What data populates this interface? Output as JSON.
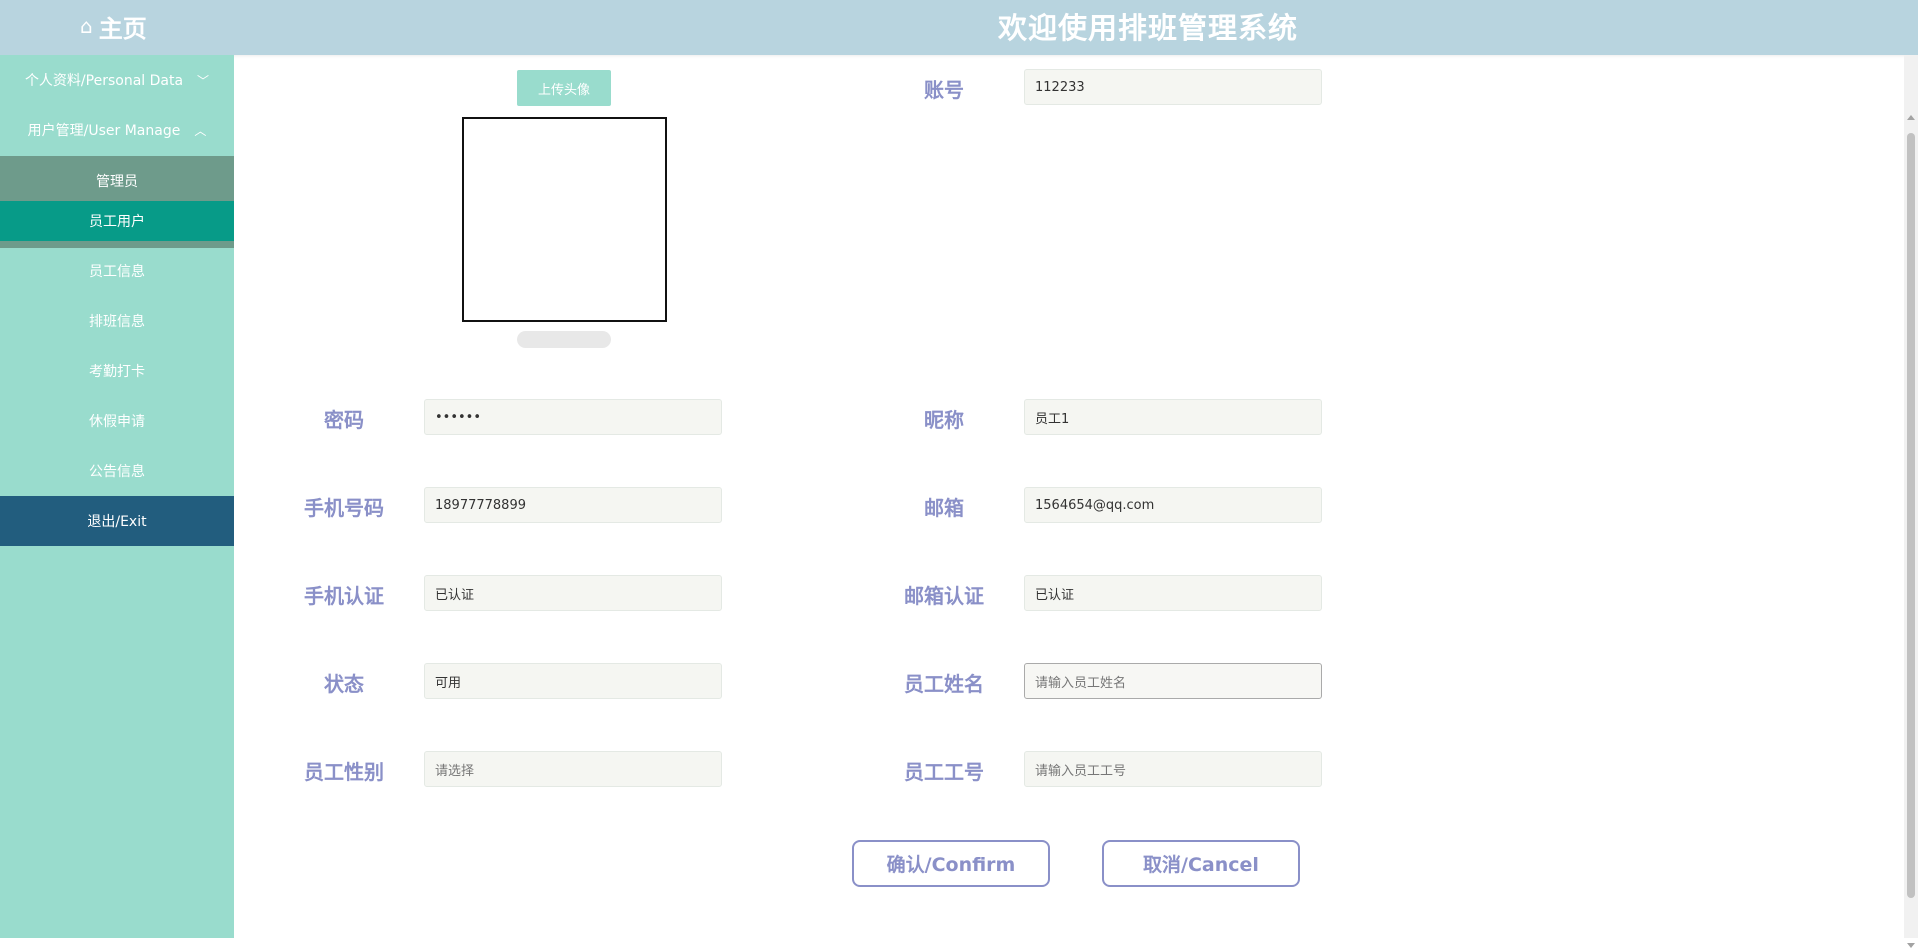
{
  "header": {
    "home_icon": "home-icon",
    "home_label": "主页",
    "title": "欢迎使用排班管理系统"
  },
  "sidebar": {
    "items": [
      {
        "label": "个人资料/Personal Data",
        "icon": "chevron-down-icon"
      },
      {
        "label": "用户管理/User Manage",
        "icon": "chevron-up-icon"
      }
    ],
    "sub_items": [
      {
        "label": "管理员"
      },
      {
        "label": "员工用户"
      }
    ],
    "more_items": [
      {
        "label": "员工信息"
      },
      {
        "label": "排班信息"
      },
      {
        "label": "考勤打卡"
      },
      {
        "label": "休假申请"
      },
      {
        "label": "公告信息"
      }
    ],
    "exit_label": "退出/Exit"
  },
  "form": {
    "upload_label": "上传头像",
    "fields": {
      "account": {
        "label": "账号",
        "value": "112233"
      },
      "password": {
        "label": "密码",
        "value": "••••••"
      },
      "nickname": {
        "label": "昵称",
        "value": "员工1"
      },
      "phone": {
        "label": "手机号码",
        "value": "18977778899"
      },
      "email": {
        "label": "邮箱",
        "value": "1564654@qq.com"
      },
      "phone_verify": {
        "label": "手机认证",
        "value": "已认证"
      },
      "email_verify": {
        "label": "邮箱认证",
        "value": "已认证"
      },
      "status": {
        "label": "状态",
        "value": "可用"
      },
      "staff_name": {
        "label": "员工姓名",
        "placeholder": "请输入员工姓名"
      },
      "staff_gender": {
        "label": "员工性别",
        "placeholder": "请选择"
      },
      "staff_no": {
        "label": "员工工号",
        "placeholder": "请输入员工工号"
      }
    },
    "confirm_label": "确认/Confirm",
    "cancel_label": "取消/Cancel"
  },
  "colors": {
    "header_bg": "#b8d4df",
    "sidebar_bg": "#99dccd",
    "active_item": "#079b88",
    "exit_bg": "#225d7e",
    "label_color": "#8a90c8"
  }
}
